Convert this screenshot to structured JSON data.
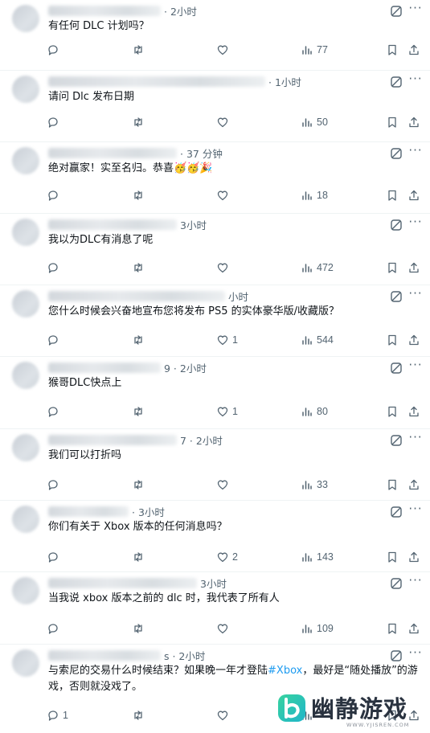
{
  "replies": [
    {
      "name_w": 140,
      "time": "· 2小时",
      "text": "有任何 DLC 计划吗？",
      "reply_count": "",
      "repost_count": "",
      "like_count": "",
      "views": "77"
    },
    {
      "name_w": 270,
      "time": "· 1小时",
      "text": "请问 Dlc 发布日期",
      "reply_count": "",
      "repost_count": "",
      "like_count": "",
      "views": "50"
    },
    {
      "name_w": 160,
      "time": "· 37 分钟",
      "text": "绝对赢家！实至名归。恭喜🥳🥳🎉",
      "reply_count": "",
      "repost_count": "",
      "like_count": "",
      "views": "18"
    },
    {
      "name_w": 160,
      "time": "3小时",
      "text": "我以为DLC有消息了呢",
      "reply_count": "",
      "repost_count": "",
      "like_count": "",
      "views": "472"
    },
    {
      "name_w": 220,
      "time": "小时",
      "text": "您什么时候会兴奋地宣布您将发布 PS5 的实体豪华版/收藏版？",
      "reply_count": "",
      "repost_count": "",
      "like_count": "1",
      "views": "544"
    },
    {
      "name_w": 140,
      "time": "9 · 2小时",
      "text": "猴哥DLC快点上",
      "reply_count": "",
      "repost_count": "",
      "like_count": "1",
      "views": "80"
    },
    {
      "name_w": 160,
      "time": "7 · 2小时",
      "text": "我们可以打折吗",
      "reply_count": "",
      "repost_count": "",
      "like_count": "",
      "views": "33"
    },
    {
      "name_w": 100,
      "time": "· 3小时",
      "text": "你们有关于 Xbox 版本的任何消息吗？",
      "reply_count": "",
      "repost_count": "",
      "like_count": "2",
      "views": "143"
    },
    {
      "name_w": 185,
      "time": "3小时",
      "text": "当我说 xbox 版本之前的 dlc 时，我代表了所有人",
      "reply_count": "",
      "repost_count": "",
      "like_count": "",
      "views": "109"
    },
    {
      "name_w": 140,
      "time": "s · 2小时",
      "text_before": "与索尼的交易什么时候结束？如果晚一年才登陆",
      "hashtag": "#Xbox",
      "text_after": "，最好是“随处播放”的游戏，否则就没戏了。",
      "reply_count": "1",
      "repost_count": "",
      "like_count": "",
      "views": ""
    }
  ],
  "watermark": {
    "title": "幽静游戏",
    "url": "WWW.YJISREN.COM"
  },
  "colors": {
    "text": "#0f1419",
    "muted": "#536471",
    "link": "#1d9bf0",
    "divider": "#eff3f4"
  },
  "icons": [
    "reply-icon",
    "repost-icon",
    "like-icon",
    "views-icon",
    "bookmark-icon",
    "share-icon",
    "grok-icon",
    "more-icon"
  ]
}
